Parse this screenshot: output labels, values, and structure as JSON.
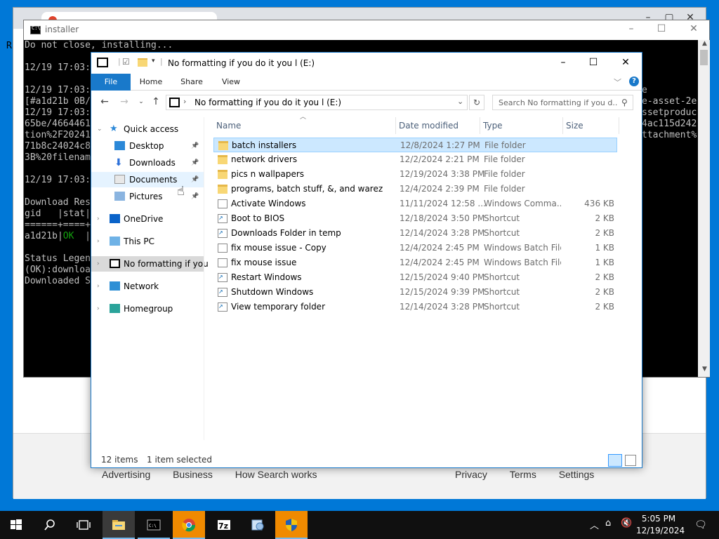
{
  "browser": {
    "footer_left": [
      "Advertising",
      "Business",
      "How Search works"
    ],
    "footer_right": [
      "Privacy",
      "Terms",
      "Settings"
    ],
    "peek_letter": "R"
  },
  "console": {
    "title": "installer",
    "lines_left": [
      "Do not close, installing...",
      "",
      "12/19 17:03:",
      "",
      "12/19 17:03:",
      "[#a1d21b 0B/",
      "12/19 17:03:",
      "65be/4664461",
      "tion%2F20241",
      "71b8c24024c8",
      "3B%20filenam",
      "",
      "12/19 17:03:",
      "",
      "Download Res",
      "gid   |stat|",
      "======+====+",
      "a1d21b|OK  |",
      "",
      "Status Legen",
      "(OK):downloa",
      "Downloaded S"
    ],
    "lines_right": [
      "e",
      "e-asset-2e",
      "ssetproduc",
      "4ac115d242",
      "ttachment%"
    ]
  },
  "explorer": {
    "title": "No formatting if you do it you l (E:)",
    "ribbon_tabs": [
      "File",
      "Home",
      "Share",
      "View"
    ],
    "address": "No formatting if you do it you l (E:)",
    "search_placeholder": "Search No formatting if you d...",
    "nav": [
      {
        "label": "Quick access",
        "icon": "star-icon"
      },
      {
        "label": "Desktop",
        "icon": "desktop-icon"
      },
      {
        "label": "Downloads",
        "icon": "download-icon"
      },
      {
        "label": "Documents",
        "icon": "documents-icon"
      },
      {
        "label": "Pictures",
        "icon": "pictures-icon"
      },
      {
        "label": "OneDrive",
        "icon": "cloud-icon"
      },
      {
        "label": "This PC",
        "icon": "computer-icon"
      },
      {
        "label": "No formatting if you",
        "icon": "drive-icon"
      },
      {
        "label": "Network",
        "icon": "network-icon"
      },
      {
        "label": "Homegroup",
        "icon": "homegroup-icon"
      }
    ],
    "columns": [
      "Name",
      "Date modified",
      "Type",
      "Size"
    ],
    "files": [
      {
        "name": "batch installers",
        "date": "12/8/2024 1:27 PM",
        "type": "File folder",
        "size": "",
        "icon": "folder-icon"
      },
      {
        "name": "network drivers",
        "date": "12/2/2024 2:21 PM",
        "type": "File folder",
        "size": "",
        "icon": "folder-icon"
      },
      {
        "name": "pics n wallpapers",
        "date": "12/19/2024 3:38 PM",
        "type": "File folder",
        "size": "",
        "icon": "folder-icon"
      },
      {
        "name": "programs, batch stuff, &, and warez",
        "date": "12/4/2024 2:39 PM",
        "type": "File folder",
        "size": "",
        "icon": "folder-icon"
      },
      {
        "name": "Activate Windows",
        "date": "11/11/2024 12:58 ...",
        "type": "Windows Comma...",
        "size": "436 KB",
        "icon": "script-file-icon"
      },
      {
        "name": "Boot to BIOS",
        "date": "12/18/2024 3:50 PM",
        "type": "Shortcut",
        "size": "2 KB",
        "icon": "shortcut-icon"
      },
      {
        "name": "Downloads Folder in temp",
        "date": "12/14/2024 3:28 PM",
        "type": "Shortcut",
        "size": "2 KB",
        "icon": "shortcut-icon"
      },
      {
        "name": "fix mouse issue - Copy",
        "date": "12/4/2024 2:45 PM",
        "type": "Windows Batch File",
        "size": "1 KB",
        "icon": "batch-file-icon"
      },
      {
        "name": "fix mouse issue",
        "date": "12/4/2024 2:45 PM",
        "type": "Windows Batch File",
        "size": "1 KB",
        "icon": "batch-file-icon"
      },
      {
        "name": "Restart Windows",
        "date": "12/15/2024 9:40 PM",
        "type": "Shortcut",
        "size": "2 KB",
        "icon": "shortcut-icon"
      },
      {
        "name": "Shutdown Windows",
        "date": "12/15/2024 9:39 PM",
        "type": "Shortcut",
        "size": "2 KB",
        "icon": "shortcut-icon"
      },
      {
        "name": "View temporary folder",
        "date": "12/14/2024 3:28 PM",
        "type": "Shortcut",
        "size": "2 KB",
        "icon": "shortcut-icon"
      }
    ],
    "status_count": "12 items",
    "status_selection": "1 item selected"
  },
  "taskbar": {
    "apps": [
      "start-icon",
      "search-icon",
      "task-view-icon",
      "file-explorer-icon",
      "command-prompt-icon",
      "chrome-icon",
      "7zip-icon",
      "app-icon",
      "shield-icon"
    ],
    "time": "5:05 PM",
    "date": "12/19/2024"
  },
  "colors": {
    "accent": "#1979ca",
    "selection": "#cce8ff",
    "console_ok": "#13a10e"
  }
}
